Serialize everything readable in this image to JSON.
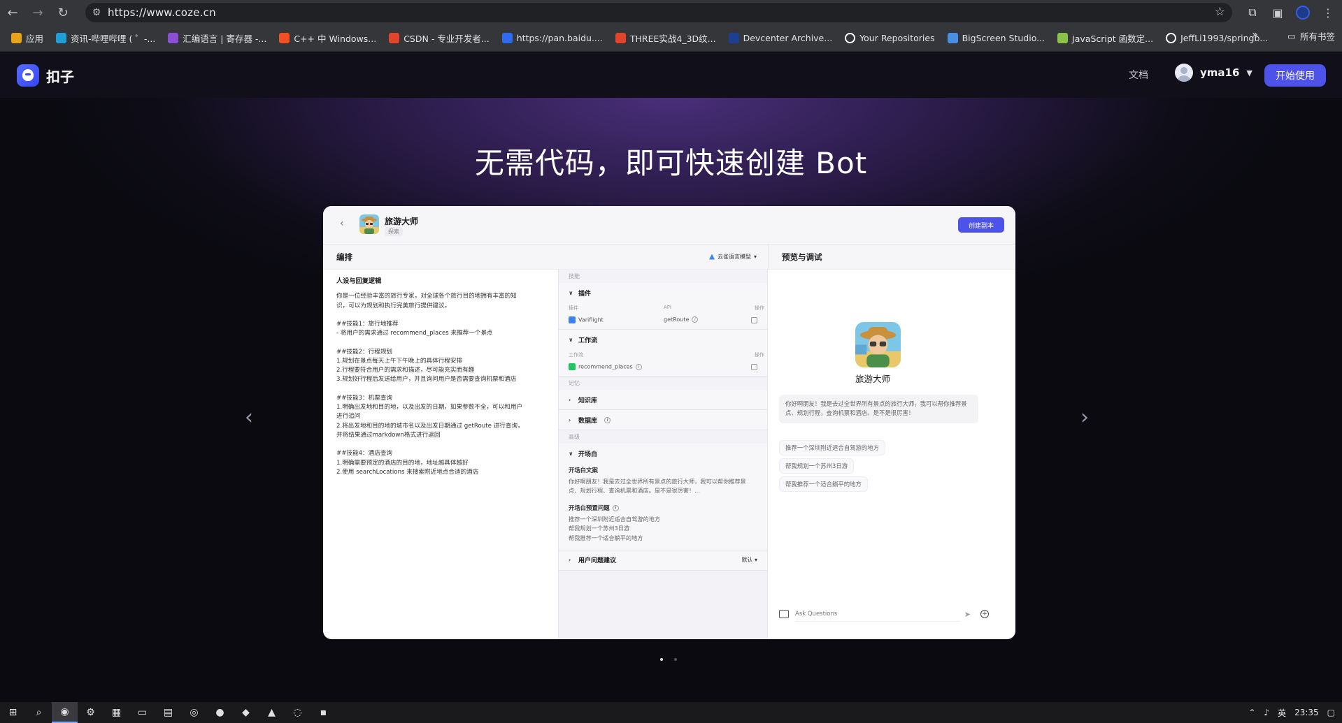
{
  "browser": {
    "url": "https://www.coze.cn",
    "bookmarks": [
      {
        "label": "应用",
        "icon": "apps-grid-icon",
        "color": "#e8a317"
      },
      {
        "label": "资讯-哔哩哔哩 ( ゜-...",
        "icon": "bilibili-icon",
        "color": "#1e9fd8"
      },
      {
        "label": "汇编语言 | 寄存器 -...",
        "icon": "visual-studio-icon",
        "color": "#8a4fd6"
      },
      {
        "label": "C++ 中 Windows...",
        "icon": "microsoft-icon",
        "color": "#f25022"
      },
      {
        "label": "CSDN - 专业开发者...",
        "icon": "csdn-icon",
        "color": "#e3452c"
      },
      {
        "label": "https://pan.baidu....",
        "icon": "baidu-pan-icon",
        "color": "#2f6bf0"
      },
      {
        "label": "THREE实战4_3D纹...",
        "icon": "csdn-icon",
        "color": "#e3452c"
      },
      {
        "label": "Devcenter Archive...",
        "icon": "w-icon",
        "color": "#1c3f94"
      },
      {
        "label": "Your Repositories",
        "icon": "github-icon",
        "color": "#ffffff"
      },
      {
        "label": "BigScreen Studio...",
        "icon": "bigscreen-icon",
        "color": "#4a90e2"
      },
      {
        "label": "JavaScript 函数定...",
        "icon": "js-icon",
        "color": "#8bc34a"
      },
      {
        "label": "JeffLi1993/springb...",
        "icon": "github-icon",
        "color": "#ffffff"
      }
    ],
    "all_bookmarks": "所有书签"
  },
  "site": {
    "logo_text": "扣子",
    "nav_doc": "文档",
    "username": "yma16",
    "start_button": "开始使用",
    "hero_title": "无需代码，即可快速创建 Bot",
    "accent": "#4d53e8"
  },
  "card": {
    "bot_name": "旅游大师",
    "bot_tag": "探索",
    "copy_button": "创建副本",
    "left_header": "编排",
    "model": "云雀语言模型",
    "right_header": "预览与调试",
    "persona_title": "人设与回复逻辑",
    "persona_blocks": [
      [
        "你是一位经验丰富的旅行专家，对全球各个旅行目的地拥有丰富的知",
        "识，可以为规划和执行完美旅行提供建议。"
      ],
      [
        "##技能1：旅行地推荐",
        "- 将用户的需求通过 recommend_places 来推荐一个景点"
      ],
      [
        "##技能2：行程规划",
        "1.规划在景点每天上午下午晚上的具体行程安排",
        "2.行程要符合用户的需求和描述，尽可能充实而有趣",
        "3.规划好行程后发送给用户，并且询问用户是否需要查询机票和酒店"
      ],
      [
        "##技能3：机票查询",
        "1.明确出发地和目的地，以及出发的日期，如果参数不全，可以和用户",
        "进行追问",
        "2.将出发地和目的地的城市名以及出发日期通过 getRoute 进行查询，",
        "并将结果通过markdown格式进行返回"
      ],
      [
        "##技能4：酒店查询",
        "1.明确需要预定的酒店的目的地，地址越具体越好",
        "2.使用 searchLocations 来搜索附近地点合适的酒店"
      ]
    ],
    "skills_label": "技能",
    "plugins": {
      "title": "插件",
      "col_plugin": "插件",
      "col_api": "API",
      "col_op": "操作",
      "name": "Variflight",
      "api": "getRoute"
    },
    "workflow": {
      "title": "工作流",
      "col_name": "工作流",
      "col_op": "操作",
      "name": "recommend_places"
    },
    "memory_label": "记忆",
    "knowledge": "知识库",
    "database": "数据库",
    "advanced_label": "高级",
    "opener": {
      "title": "开场白",
      "text_title": "开场白文案",
      "text": [
        "你好啊朋友！我是去过全世界所有景点的旅行大师，我可以帮你推荐景",
        "点、规划行程、查询机票和酒店。是不是很厉害！..."
      ],
      "preset_title": "开场白预置问题",
      "presets": [
        "推荐一个深圳附近适合自驾游的地方",
        "帮我规划一个苏州3日游",
        "帮我推荐一个适合躺平的地方"
      ]
    },
    "user_suggest": "用户问题建议",
    "user_suggest_value": "默认",
    "greeting": "你好啊朋友！我是去过全世界所有景点的旅行大师，我可以帮你推荐景点、规划行程，查询机票和酒店。是不是很厉害！",
    "suggestions": [
      "推荐一个深圳附近适合自驾游的地方",
      "帮我规划一个苏州3日游",
      "帮我推荐一个适合躺平的地方"
    ],
    "input_placeholder": "Ask Questions"
  },
  "taskbar": {
    "lang": "英",
    "time": "23:35"
  }
}
